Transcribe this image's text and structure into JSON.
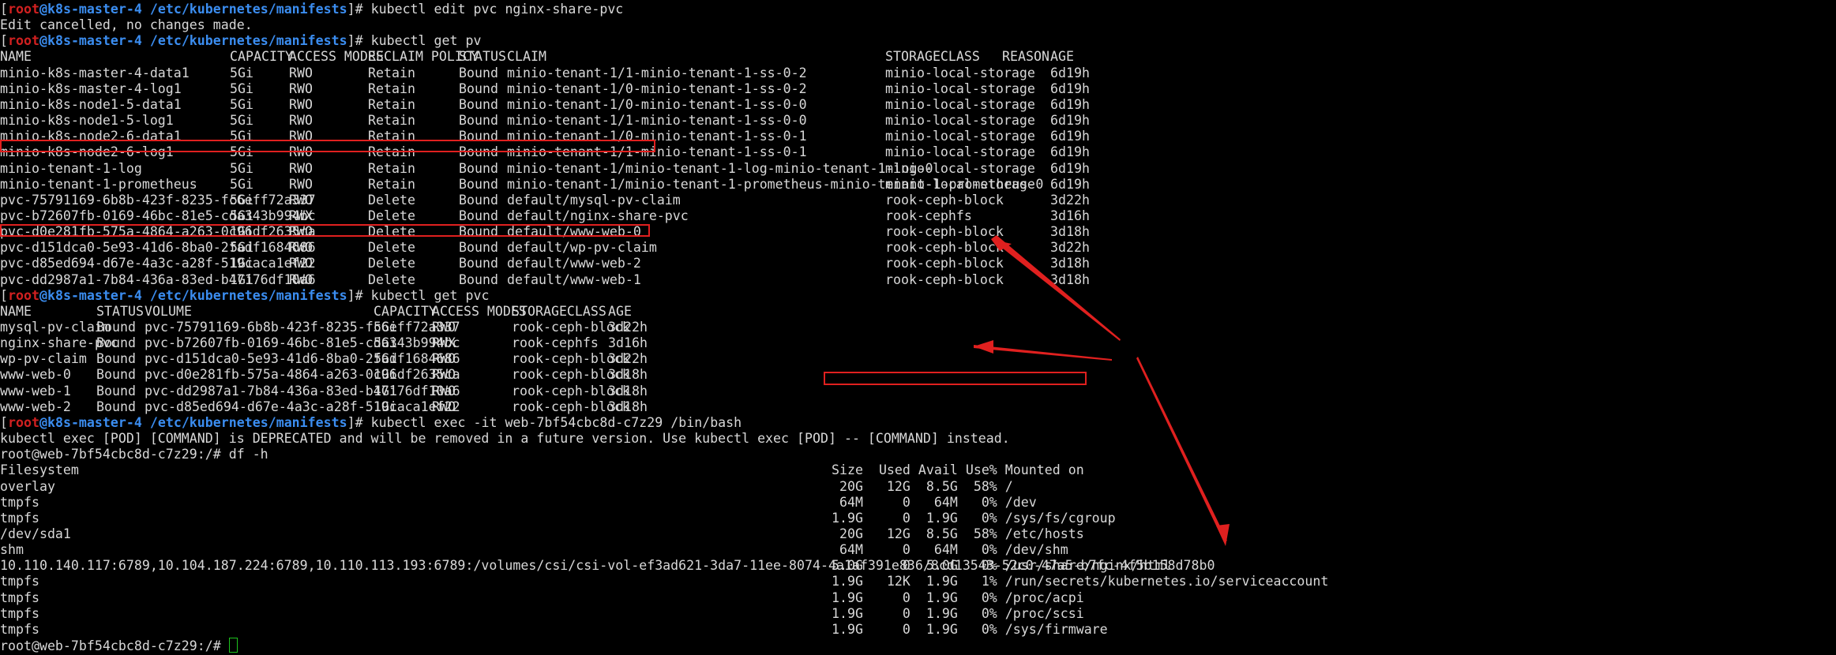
{
  "prompt": {
    "user": "root",
    "at": "@",
    "host": "k8s-master-4",
    "path": "/etc/kubernetes/manifests",
    "symbol": "#"
  },
  "lines": {
    "l1_cmd": "kubectl edit pvc nginx-share-pvc",
    "l2": "Edit cancelled, no changes made.",
    "l3_cmd": "kubectl get pv",
    "l29_cmd": "kubectl exec -it web-7bf54cbc8d-c7z29 /bin/bash",
    "l30": "kubectl exec [POD] [COMMAND] is DEPRECATED and will be removed in a future version. Use kubectl exec [POD] -- [COMMAND] instead.",
    "l31": "root@web-7bf54cbc8d-c7z29:/# df -h",
    "l_last": "root@web-7bf54cbc8d-c7z29:/# "
  },
  "pv_table": {
    "headers": [
      "NAME",
      "CAPACITY",
      "ACCESS MODES",
      "RECLAIM POLICY",
      "STATUS",
      "CLAIM",
      "STORAGECLASS",
      "REASON",
      "AGE"
    ],
    "rows": [
      [
        "minio-k8s-master-4-data1",
        "5Gi",
        "RWO",
        "Retain",
        "Bound",
        "minio-tenant-1/1-minio-tenant-1-ss-0-2",
        "minio-local-storage",
        "",
        "6d19h"
      ],
      [
        "minio-k8s-master-4-log1",
        "5Gi",
        "RWO",
        "Retain",
        "Bound",
        "minio-tenant-1/0-minio-tenant-1-ss-0-2",
        "minio-local-storage",
        "",
        "6d19h"
      ],
      [
        "minio-k8s-node1-5-data1",
        "5Gi",
        "RWO",
        "Retain",
        "Bound",
        "minio-tenant-1/0-minio-tenant-1-ss-0-0",
        "minio-local-storage",
        "",
        "6d19h"
      ],
      [
        "minio-k8s-node1-5-log1",
        "5Gi",
        "RWO",
        "Retain",
        "Bound",
        "minio-tenant-1/1-minio-tenant-1-ss-0-0",
        "minio-local-storage",
        "",
        "6d19h"
      ],
      [
        "minio-k8s-node2-6-data1",
        "5Gi",
        "RWO",
        "Retain",
        "Bound",
        "minio-tenant-1/0-minio-tenant-1-ss-0-1",
        "minio-local-storage",
        "",
        "6d19h"
      ],
      [
        "minio-k8s-node2-6-log1",
        "5Gi",
        "RWO",
        "Retain",
        "Bound",
        "minio-tenant-1/1-minio-tenant-1-ss-0-1",
        "minio-local-storage",
        "",
        "6d19h"
      ],
      [
        "minio-tenant-1-log",
        "5Gi",
        "RWO",
        "Retain",
        "Bound",
        "minio-tenant-1/minio-tenant-1-log-minio-tenant-1-log-0",
        "minio-local-storage",
        "",
        "6d19h"
      ],
      [
        "minio-tenant-1-prometheus",
        "5Gi",
        "RWO",
        "Retain",
        "Bound",
        "minio-tenant-1/minio-tenant-1-prometheus-minio-tenant-1-prometheus-0",
        "minio-local-storage",
        "",
        "6d19h"
      ],
      [
        "pvc-75791169-6b8b-423f-8235-fc6eff72a337",
        "5Gi",
        "RWO",
        "Delete",
        "Bound",
        "default/mysql-pv-claim",
        "rook-ceph-block",
        "",
        "3d22h"
      ],
      [
        "pvc-b72607fb-0169-46bc-81e5-cda343b994bc",
        "5Gi",
        "RWX",
        "Delete",
        "Bound",
        "default/nginx-share-pvc",
        "rook-cephfs",
        "",
        "3d16h"
      ],
      [
        "pvc-d0e281fb-575a-4864-a263-0c96df2635ca",
        "1Gi",
        "RWO",
        "Delete",
        "Bound",
        "default/www-web-0",
        "rook-ceph-block",
        "",
        "3d18h"
      ],
      [
        "pvc-d151dca0-5e93-41d6-8ba0-2fadf1684686",
        "5Gi",
        "RWO",
        "Delete",
        "Bound",
        "default/wp-pv-claim",
        "rook-ceph-block",
        "",
        "3d22h"
      ],
      [
        "pvc-d85ed694-d67e-4a3c-a28f-519caca1ef22",
        "1Gi",
        "RWO",
        "Delete",
        "Bound",
        "default/www-web-2",
        "rook-ceph-block",
        "",
        "3d18h"
      ],
      [
        "pvc-dd2987a1-7b84-436a-83ed-b47176df10a6",
        "1Gi",
        "RWO",
        "Delete",
        "Bound",
        "default/www-web-1",
        "rook-ceph-block",
        "",
        "3d18h"
      ]
    ]
  },
  "pvc_cmd": "kubectl get pvc",
  "pvc_table": {
    "headers": [
      "NAME",
      "STATUS",
      "VOLUME",
      "CAPACITY",
      "ACCESS MODES",
      "STORAGECLASS",
      "AGE"
    ],
    "rows": [
      [
        "mysql-pv-claim",
        "Bound",
        "pvc-75791169-6b8b-423f-8235-fc6eff72a337",
        "5Gi",
        "RWO",
        "rook-ceph-block",
        "3d22h"
      ],
      [
        "nginx-share-pvc",
        "Bound",
        "pvc-b72607fb-0169-46bc-81e5-cda343b994bc",
        "5Gi",
        "RWX",
        "rook-cephfs",
        "3d16h"
      ],
      [
        "wp-pv-claim",
        "Bound",
        "pvc-d151dca0-5e93-41d6-8ba0-2fadf1684686",
        "5Gi",
        "RWO",
        "rook-ceph-block",
        "3d22h"
      ],
      [
        "www-web-0",
        "Bound",
        "pvc-d0e281fb-575a-4864-a263-0c96df2635ca",
        "1Gi",
        "RWO",
        "rook-ceph-block",
        "3d18h"
      ],
      [
        "www-web-1",
        "Bound",
        "pvc-dd2987a1-7b84-436a-83ed-b47176df10a6",
        "1Gi",
        "RWO",
        "rook-ceph-block",
        "3d18h"
      ],
      [
        "www-web-2",
        "Bound",
        "pvc-d85ed694-d67e-4a3c-a28f-519caca1ef22",
        "1Gi",
        "RWO",
        "rook-ceph-block",
        "3d18h"
      ]
    ]
  },
  "df_table": {
    "filesystem_header": "Filesystem",
    "size_header": "Size  Used Avail Use% Mounted on",
    "rows": [
      [
        "overlay",
        " 20G   12G  8.5G  58% /"
      ],
      [
        "tmpfs",
        " 64M     0   64M   0% /dev"
      ],
      [
        "tmpfs",
        "1.9G     0  1.9G   0% /sys/fs/cgroup"
      ],
      [
        "/dev/sda1",
        " 20G   12G  8.5G  58% /etc/hosts"
      ],
      [
        "shm",
        " 64M     0   64M   0% /dev/shm"
      ],
      [
        "10.110.140.117:6789,10.104.187.224:6789,10.110.113.193:6789:/volumes/csi/csi-vol-ef3ad621-3da7-11ee-8074-4a1af391e836/8cd13543-52c0-47a5-b7fc-4f5b158d78b0",
        "5.0G     0  5.0G   0% /usr/share/nginx/html"
      ],
      [
        "tmpfs",
        "1.9G   12K  1.9G   1% /run/secrets/kubernetes.io/serviceaccount"
      ],
      [
        "tmpfs",
        "1.9G     0  1.9G   0% /proc/acpi"
      ],
      [
        "tmpfs",
        "1.9G     0  1.9G   0% /proc/scsi"
      ],
      [
        "tmpfs",
        "1.9G     0  1.9G   0% /sys/firmware"
      ]
    ]
  },
  "colors": {
    "background": "#000000",
    "text": "#d8d8d8",
    "prompt_user": "#d02020",
    "prompt_host": "#3b8df0",
    "highlight": "#e0201f",
    "cursor": "#1ec21e"
  }
}
